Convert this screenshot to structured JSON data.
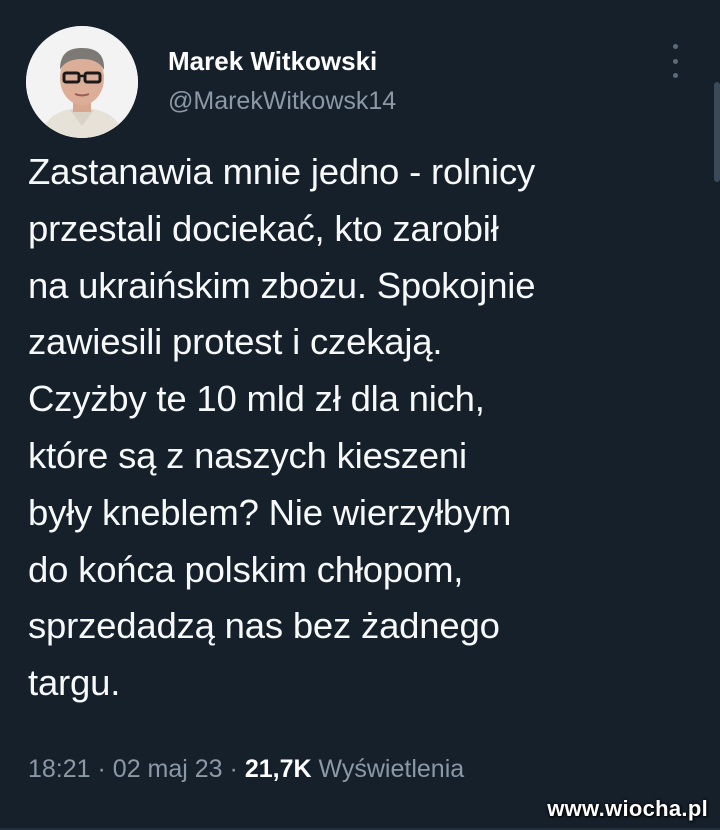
{
  "author": {
    "display_name": "Marek Witkowski",
    "handle": "@MarekWitkowsk14"
  },
  "tweet": {
    "text": "Zastanawia mnie jedno - rolnicy\nprzestali dociekać, kto zarobił\nna ukraińskim zbożu. Spokojnie\nzawiesili protest i czekają.\nCzyżby te 10 mld zł dla nich,\nktóre są z naszych kieszeni\nbyły kneblem? Nie wierzyłbym\ndo końca polskim chłopom,\nsprzedadzą nas bez żadnego\ntargu."
  },
  "meta": {
    "time": "18:21",
    "separator": "·",
    "date": "02 maj 23",
    "views_count": "21,7K",
    "views_label": "Wyświetlenia"
  },
  "watermark": "www.wiocha.pl",
  "icons": {
    "more": "more-vertical-icon"
  },
  "colors": {
    "background": "#15202b",
    "text": "#f7f9f9",
    "secondary": "#8b98a5"
  }
}
